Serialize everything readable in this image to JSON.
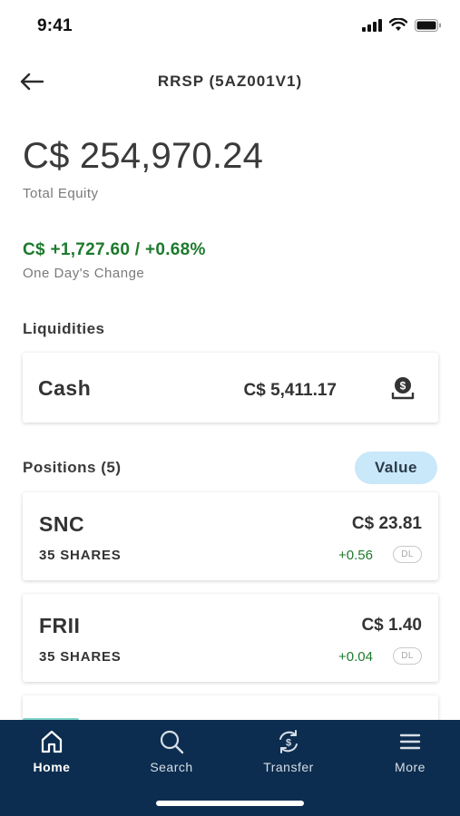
{
  "status_bar": {
    "time": "9:41"
  },
  "header": {
    "title": "RRSP (5AZ001V1)"
  },
  "summary": {
    "total_equity": "C$ 254,970.24",
    "total_equity_label": "Total Equity",
    "day_change": "C$ +1,727.60 / +0.68%",
    "day_change_label": "One Day's Change",
    "positive_color": "#1c7a2c"
  },
  "liquidities": {
    "title": "Liquidities",
    "cash_label": "Cash",
    "cash_amount": "C$ 5,411.17",
    "icon": "deposit-icon"
  },
  "positions": {
    "title": "Positions (5)",
    "sort_toggle": "Value",
    "items": [
      {
        "symbol": "SNC",
        "shares": "35 SHARES",
        "price": "C$ 23.81",
        "change": "+0.56",
        "badge": "DL"
      },
      {
        "symbol": "FRII",
        "shares": "35 SHARES",
        "price": "C$ 1.40",
        "change": "+0.04",
        "badge": "DL"
      }
    ]
  },
  "bottom_nav": {
    "background": "#0c2d4f",
    "items": [
      {
        "label": "Home",
        "icon": "home-icon",
        "active": true
      },
      {
        "label": "Search",
        "icon": "search-icon",
        "active": false
      },
      {
        "label": "Transfer",
        "icon": "transfer-icon",
        "active": false
      },
      {
        "label": "More",
        "icon": "menu-icon",
        "active": false
      }
    ]
  }
}
